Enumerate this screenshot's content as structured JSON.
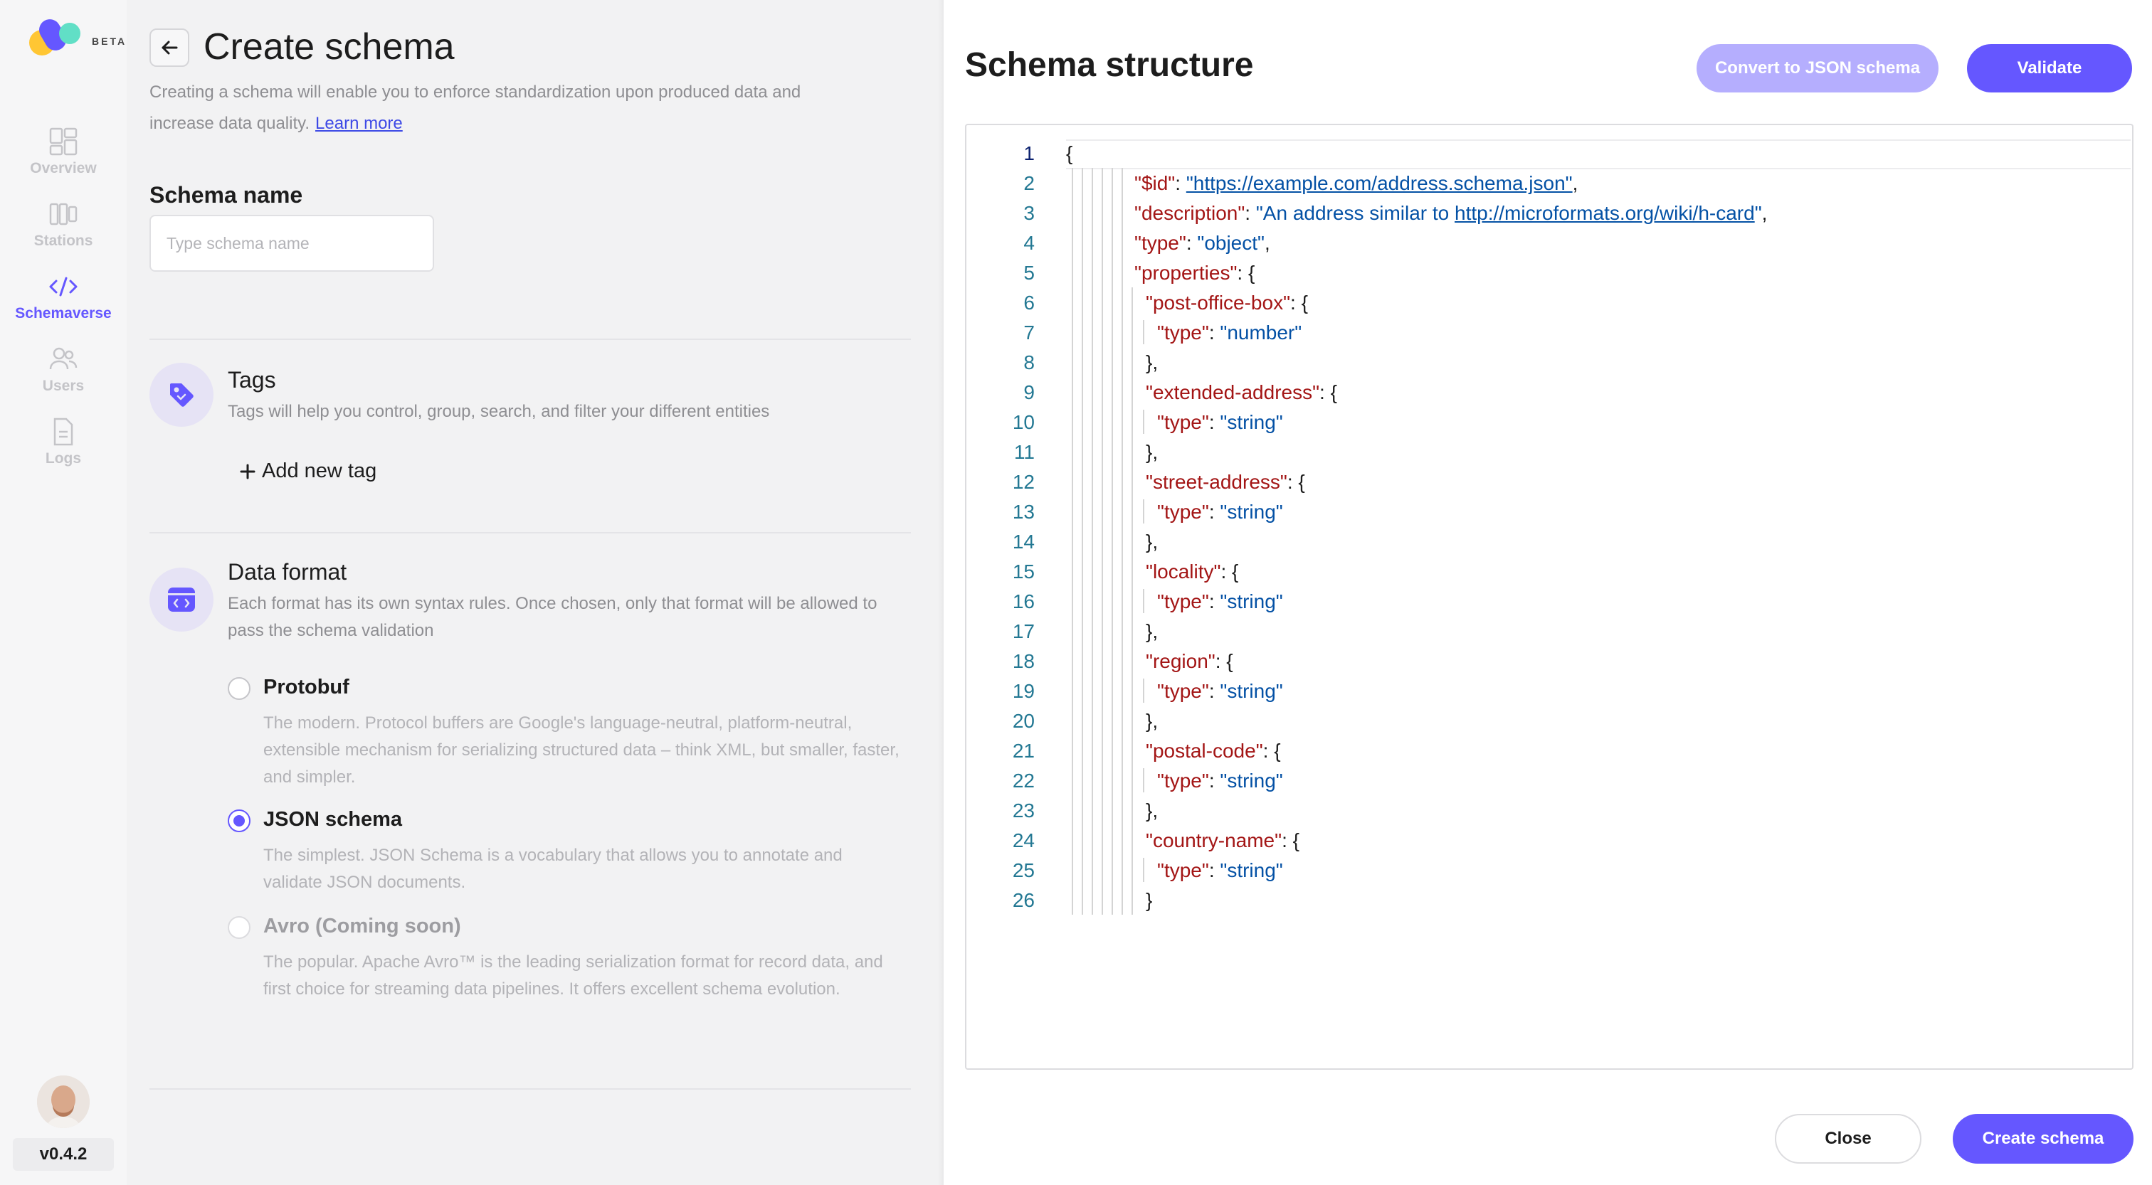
{
  "logo": {
    "badge": "BETA"
  },
  "nav": [
    {
      "label": "Overview",
      "icon": "overview-icon",
      "active": false
    },
    {
      "label": "Stations",
      "icon": "stations-icon",
      "active": false
    },
    {
      "label": "Schemaverse",
      "icon": "code-icon",
      "active": true
    },
    {
      "label": "Users",
      "icon": "users-icon",
      "active": false
    },
    {
      "label": "Logs",
      "icon": "logs-icon",
      "active": false
    }
  ],
  "version": "v0.4.2",
  "page": {
    "title": "Create schema",
    "description": "Creating a schema will enable you to enforce standardization upon produced data and increase data quality.",
    "learn_more": "Learn more"
  },
  "schema_name": {
    "label": "Schema name",
    "placeholder": "Type schema name",
    "value": ""
  },
  "tags": {
    "title": "Tags",
    "subtitle": "Tags will help you control, group, search, and filter your different entities",
    "add_label": "Add new tag"
  },
  "data_format": {
    "title": "Data format",
    "subtitle": "Each format has its own syntax rules. Once chosen, only that format will be allowed to pass the schema validation",
    "options": [
      {
        "title": "Protobuf",
        "description": "The modern. Protocol buffers are Google's language-neutral, platform-neutral, extensible mechanism for serializing structured data – think XML, but smaller, faster, and simpler.",
        "selected": false,
        "disabled": false
      },
      {
        "title": "JSON schema",
        "description": "The simplest. JSON Schema is a vocabulary that allows you to annotate and validate JSON documents.",
        "selected": true,
        "disabled": false
      },
      {
        "title": "Avro (Coming soon)",
        "description": "The popular. Apache Avro™ is the leading serialization format for record data, and first choice for streaming data pipelines. It offers excellent schema evolution.",
        "selected": false,
        "disabled": true
      }
    ]
  },
  "structure": {
    "title": "Schema structure",
    "convert_label": "Convert to JSON schema",
    "validate_label": "Validate",
    "close_label": "Close",
    "create_label": "Create schema"
  },
  "code_lines": [
    {
      "n": "1",
      "depth": 0,
      "parts": [
        [
          "p",
          "{"
        ]
      ]
    },
    {
      "n": "2",
      "depth": 1,
      "parts": [
        [
          "k",
          "\"$id\""
        ],
        [
          "p",
          ": "
        ],
        [
          "u",
          "\"https://example.com/address.schema.json\""
        ],
        [
          "p",
          ","
        ]
      ]
    },
    {
      "n": "3",
      "depth": 1,
      "parts": [
        [
          "k",
          "\"description\""
        ],
        [
          "p",
          ": "
        ],
        [
          "s",
          "\"An address similar to "
        ],
        [
          "u",
          "http://microformats.org/wiki/h-card"
        ],
        [
          "s",
          "\""
        ],
        [
          "p",
          ","
        ]
      ]
    },
    {
      "n": "4",
      "depth": 1,
      "parts": [
        [
          "k",
          "\"type\""
        ],
        [
          "p",
          ": "
        ],
        [
          "s",
          "\"object\""
        ],
        [
          "p",
          ","
        ]
      ]
    },
    {
      "n": "5",
      "depth": 1,
      "parts": [
        [
          "k",
          "\"properties\""
        ],
        [
          "p",
          ": {"
        ]
      ]
    },
    {
      "n": "6",
      "depth": 2,
      "parts": [
        [
          "k",
          "\"post-office-box\""
        ],
        [
          "p",
          ": {"
        ]
      ]
    },
    {
      "n": "7",
      "depth": 3,
      "parts": [
        [
          "k",
          "\"type\""
        ],
        [
          "p",
          ": "
        ],
        [
          "s",
          "\"number\""
        ]
      ]
    },
    {
      "n": "8",
      "depth": 2,
      "parts": [
        [
          "p",
          "},"
        ]
      ]
    },
    {
      "n": "9",
      "depth": 2,
      "parts": [
        [
          "k",
          "\"extended-address\""
        ],
        [
          "p",
          ": {"
        ]
      ]
    },
    {
      "n": "10",
      "depth": 3,
      "parts": [
        [
          "k",
          "\"type\""
        ],
        [
          "p",
          ": "
        ],
        [
          "s",
          "\"string\""
        ]
      ]
    },
    {
      "n": "11",
      "depth": 2,
      "parts": [
        [
          "p",
          "},"
        ]
      ]
    },
    {
      "n": "12",
      "depth": 2,
      "parts": [
        [
          "k",
          "\"street-address\""
        ],
        [
          "p",
          ": {"
        ]
      ]
    },
    {
      "n": "13",
      "depth": 3,
      "parts": [
        [
          "k",
          "\"type\""
        ],
        [
          "p",
          ": "
        ],
        [
          "s",
          "\"string\""
        ]
      ]
    },
    {
      "n": "14",
      "depth": 2,
      "parts": [
        [
          "p",
          "},"
        ]
      ]
    },
    {
      "n": "15",
      "depth": 2,
      "parts": [
        [
          "k",
          "\"locality\""
        ],
        [
          "p",
          ": {"
        ]
      ]
    },
    {
      "n": "16",
      "depth": 3,
      "parts": [
        [
          "k",
          "\"type\""
        ],
        [
          "p",
          ": "
        ],
        [
          "s",
          "\"string\""
        ]
      ]
    },
    {
      "n": "17",
      "depth": 2,
      "parts": [
        [
          "p",
          "},"
        ]
      ]
    },
    {
      "n": "18",
      "depth": 2,
      "parts": [
        [
          "k",
          "\"region\""
        ],
        [
          "p",
          ": {"
        ]
      ]
    },
    {
      "n": "19",
      "depth": 3,
      "parts": [
        [
          "k",
          "\"type\""
        ],
        [
          "p",
          ": "
        ],
        [
          "s",
          "\"string\""
        ]
      ]
    },
    {
      "n": "20",
      "depth": 2,
      "parts": [
        [
          "p",
          "},"
        ]
      ]
    },
    {
      "n": "21",
      "depth": 2,
      "parts": [
        [
          "k",
          "\"postal-code\""
        ],
        [
          "p",
          ": {"
        ]
      ]
    },
    {
      "n": "22",
      "depth": 3,
      "parts": [
        [
          "k",
          "\"type\""
        ],
        [
          "p",
          ": "
        ],
        [
          "s",
          "\"string\""
        ]
      ]
    },
    {
      "n": "23",
      "depth": 2,
      "parts": [
        [
          "p",
          "},"
        ]
      ]
    },
    {
      "n": "24",
      "depth": 2,
      "parts": [
        [
          "k",
          "\"country-name\""
        ],
        [
          "p",
          ": {"
        ]
      ]
    },
    {
      "n": "25",
      "depth": 3,
      "parts": [
        [
          "k",
          "\"type\""
        ],
        [
          "p",
          ": "
        ],
        [
          "s",
          "\"string\""
        ]
      ]
    },
    {
      "n": "26",
      "depth": 2,
      "parts": [
        [
          "p",
          "}"
        ]
      ]
    }
  ],
  "colors": {
    "accent": "#6557ff",
    "accent_light": "#b5aefe",
    "json_key": "#a31515",
    "json_string": "#0451a5",
    "line_number": "#237893"
  }
}
